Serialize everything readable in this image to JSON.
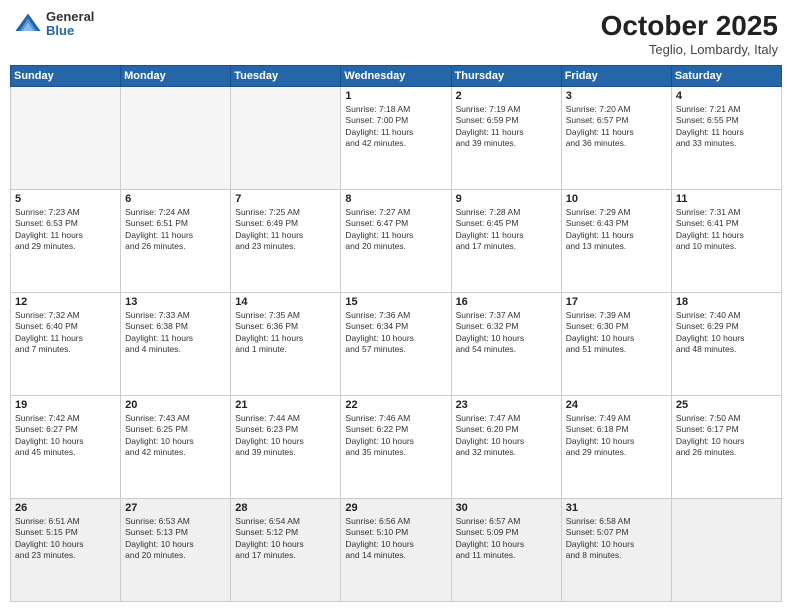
{
  "header": {
    "logo_general": "General",
    "logo_blue": "Blue",
    "month_title": "October 2025",
    "location": "Teglio, Lombardy, Italy"
  },
  "weekdays": [
    "Sunday",
    "Monday",
    "Tuesday",
    "Wednesday",
    "Thursday",
    "Friday",
    "Saturday"
  ],
  "weeks": [
    [
      {
        "day": "",
        "text": ""
      },
      {
        "day": "",
        "text": ""
      },
      {
        "day": "",
        "text": ""
      },
      {
        "day": "1",
        "text": "Sunrise: 7:18 AM\nSunset: 7:00 PM\nDaylight: 11 hours\nand 42 minutes."
      },
      {
        "day": "2",
        "text": "Sunrise: 7:19 AM\nSunset: 6:59 PM\nDaylight: 11 hours\nand 39 minutes."
      },
      {
        "day": "3",
        "text": "Sunrise: 7:20 AM\nSunset: 6:57 PM\nDaylight: 11 hours\nand 36 minutes."
      },
      {
        "day": "4",
        "text": "Sunrise: 7:21 AM\nSunset: 6:55 PM\nDaylight: 11 hours\nand 33 minutes."
      }
    ],
    [
      {
        "day": "5",
        "text": "Sunrise: 7:23 AM\nSunset: 6:53 PM\nDaylight: 11 hours\nand 29 minutes."
      },
      {
        "day": "6",
        "text": "Sunrise: 7:24 AM\nSunset: 6:51 PM\nDaylight: 11 hours\nand 26 minutes."
      },
      {
        "day": "7",
        "text": "Sunrise: 7:25 AM\nSunset: 6:49 PM\nDaylight: 11 hours\nand 23 minutes."
      },
      {
        "day": "8",
        "text": "Sunrise: 7:27 AM\nSunset: 6:47 PM\nDaylight: 11 hours\nand 20 minutes."
      },
      {
        "day": "9",
        "text": "Sunrise: 7:28 AM\nSunset: 6:45 PM\nDaylight: 11 hours\nand 17 minutes."
      },
      {
        "day": "10",
        "text": "Sunrise: 7:29 AM\nSunset: 6:43 PM\nDaylight: 11 hours\nand 13 minutes."
      },
      {
        "day": "11",
        "text": "Sunrise: 7:31 AM\nSunset: 6:41 PM\nDaylight: 11 hours\nand 10 minutes."
      }
    ],
    [
      {
        "day": "12",
        "text": "Sunrise: 7:32 AM\nSunset: 6:40 PM\nDaylight: 11 hours\nand 7 minutes."
      },
      {
        "day": "13",
        "text": "Sunrise: 7:33 AM\nSunset: 6:38 PM\nDaylight: 11 hours\nand 4 minutes."
      },
      {
        "day": "14",
        "text": "Sunrise: 7:35 AM\nSunset: 6:36 PM\nDaylight: 11 hours\nand 1 minute."
      },
      {
        "day": "15",
        "text": "Sunrise: 7:36 AM\nSunset: 6:34 PM\nDaylight: 10 hours\nand 57 minutes."
      },
      {
        "day": "16",
        "text": "Sunrise: 7:37 AM\nSunset: 6:32 PM\nDaylight: 10 hours\nand 54 minutes."
      },
      {
        "day": "17",
        "text": "Sunrise: 7:39 AM\nSunset: 6:30 PM\nDaylight: 10 hours\nand 51 minutes."
      },
      {
        "day": "18",
        "text": "Sunrise: 7:40 AM\nSunset: 6:29 PM\nDaylight: 10 hours\nand 48 minutes."
      }
    ],
    [
      {
        "day": "19",
        "text": "Sunrise: 7:42 AM\nSunset: 6:27 PM\nDaylight: 10 hours\nand 45 minutes."
      },
      {
        "day": "20",
        "text": "Sunrise: 7:43 AM\nSunset: 6:25 PM\nDaylight: 10 hours\nand 42 minutes."
      },
      {
        "day": "21",
        "text": "Sunrise: 7:44 AM\nSunset: 6:23 PM\nDaylight: 10 hours\nand 39 minutes."
      },
      {
        "day": "22",
        "text": "Sunrise: 7:46 AM\nSunset: 6:22 PM\nDaylight: 10 hours\nand 35 minutes."
      },
      {
        "day": "23",
        "text": "Sunrise: 7:47 AM\nSunset: 6:20 PM\nDaylight: 10 hours\nand 32 minutes."
      },
      {
        "day": "24",
        "text": "Sunrise: 7:49 AM\nSunset: 6:18 PM\nDaylight: 10 hours\nand 29 minutes."
      },
      {
        "day": "25",
        "text": "Sunrise: 7:50 AM\nSunset: 6:17 PM\nDaylight: 10 hours\nand 26 minutes."
      }
    ],
    [
      {
        "day": "26",
        "text": "Sunrise: 6:51 AM\nSunset: 5:15 PM\nDaylight: 10 hours\nand 23 minutes."
      },
      {
        "day": "27",
        "text": "Sunrise: 6:53 AM\nSunset: 5:13 PM\nDaylight: 10 hours\nand 20 minutes."
      },
      {
        "day": "28",
        "text": "Sunrise: 6:54 AM\nSunset: 5:12 PM\nDaylight: 10 hours\nand 17 minutes."
      },
      {
        "day": "29",
        "text": "Sunrise: 6:56 AM\nSunset: 5:10 PM\nDaylight: 10 hours\nand 14 minutes."
      },
      {
        "day": "30",
        "text": "Sunrise: 6:57 AM\nSunset: 5:09 PM\nDaylight: 10 hours\nand 11 minutes."
      },
      {
        "day": "31",
        "text": "Sunrise: 6:58 AM\nSunset: 5:07 PM\nDaylight: 10 hours\nand 8 minutes."
      },
      {
        "day": "",
        "text": ""
      }
    ]
  ]
}
